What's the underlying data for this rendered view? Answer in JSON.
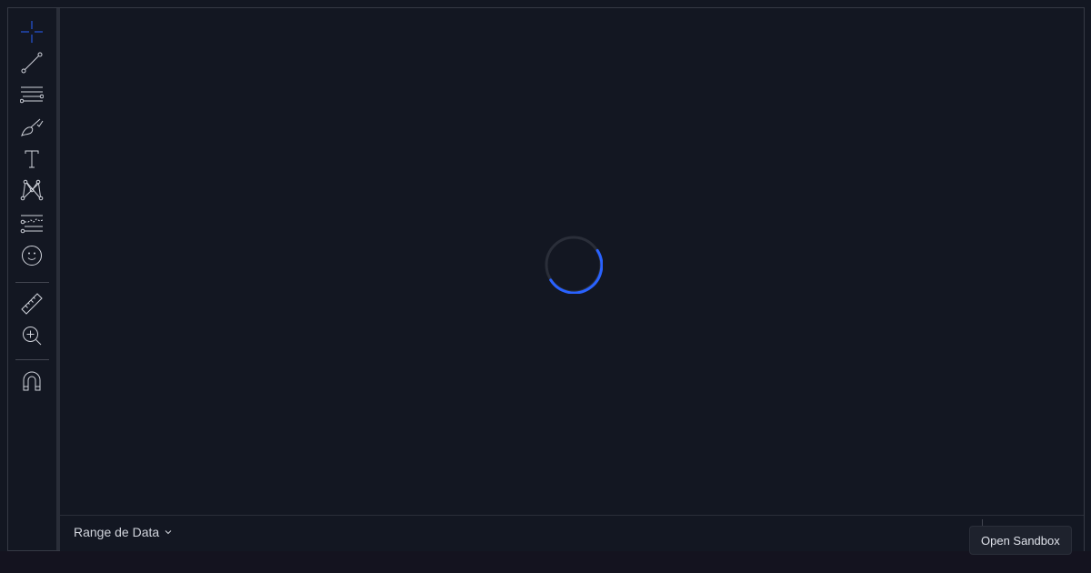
{
  "toolbar": {
    "tools": [
      {
        "name": "crosshair",
        "icon": "crosshair-icon",
        "active": true
      },
      {
        "name": "trend-line",
        "icon": "trend-line-icon"
      },
      {
        "name": "horizontal-lines",
        "icon": "horizontal-lines-icon"
      },
      {
        "name": "brush",
        "icon": "brush-icon"
      },
      {
        "name": "text",
        "icon": "text-icon"
      },
      {
        "name": "pattern",
        "icon": "pattern-icon"
      },
      {
        "name": "prediction",
        "icon": "prediction-icon"
      },
      {
        "name": "emoji",
        "icon": "emoji-icon"
      },
      {
        "name": "measure",
        "icon": "ruler-icon"
      },
      {
        "name": "zoom-in",
        "icon": "zoom-in-icon"
      },
      {
        "name": "magnet",
        "icon": "magnet-icon"
      }
    ]
  },
  "chart": {
    "loading": true
  },
  "bottom_bar": {
    "range_label": "Range de Data"
  },
  "sandbox": {
    "label": "Open Sandbox"
  },
  "colors": {
    "background": "#131722",
    "accent": "#2962ff",
    "icon": "#d1d4dc",
    "border": "#363a45"
  }
}
